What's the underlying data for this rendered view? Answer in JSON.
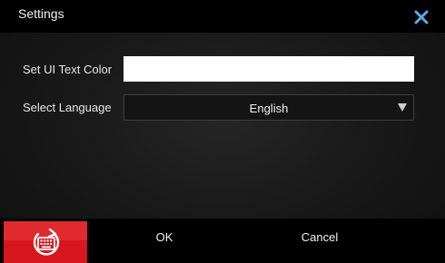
{
  "window": {
    "title": "Settings",
    "close_icon": "close-x-icon",
    "accent_color": "#5aa9e6"
  },
  "settings": {
    "text_color_label": "Set UI Text Color",
    "text_color_value": "",
    "language_label": "Select Language",
    "language_value": "English",
    "language_arrow_icon": "triangle-down-icon"
  },
  "footer": {
    "keyboard_icon": "keyboard-refresh-icon",
    "brand_color": "#d7161d",
    "ok_label": "OK",
    "cancel_label": "Cancel"
  }
}
